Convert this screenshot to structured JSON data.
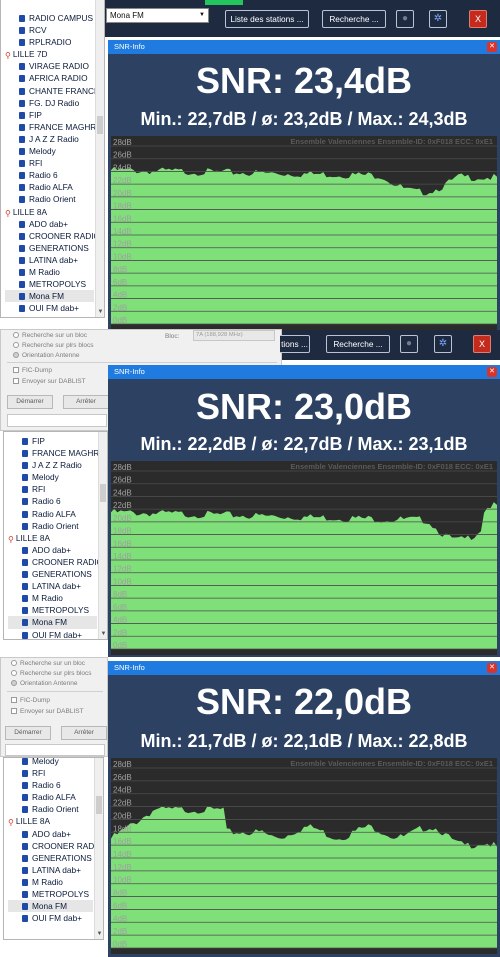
{
  "panel1": {
    "toolbar": {
      "station_select": "Mona FM",
      "stations_list_button": "Liste des stations ...",
      "search_button": "Recherche ...",
      "close_label": "X"
    },
    "stations": [
      {
        "label": "RADIO CAMPUS",
        "type": "station"
      },
      {
        "label": "RCV",
        "type": "station"
      },
      {
        "label": "RPLRADIO",
        "type": "station"
      },
      {
        "label": "LILLE 7D",
        "type": "group"
      },
      {
        "label": "VIRAGE RADIO",
        "type": "station"
      },
      {
        "label": "AFRICA RADIO",
        "type": "station"
      },
      {
        "label": "CHANTE FRANCE",
        "type": "station"
      },
      {
        "label": "FG. DJ Radio",
        "type": "station"
      },
      {
        "label": "FIP",
        "type": "station"
      },
      {
        "label": "FRANCE MAGHREB",
        "type": "station"
      },
      {
        "label": "J A Z Z Radio",
        "type": "station"
      },
      {
        "label": "Melody",
        "type": "station"
      },
      {
        "label": "RFI",
        "type": "station"
      },
      {
        "label": "Radio 6",
        "type": "station"
      },
      {
        "label": "Radio ALFA",
        "type": "station"
      },
      {
        "label": "Radio Orient",
        "type": "station"
      },
      {
        "label": "LILLE 8A",
        "type": "group"
      },
      {
        "label": "ADO dab+",
        "type": "station"
      },
      {
        "label": "CROONER RADIO",
        "type": "station"
      },
      {
        "label": "GENERATIONS",
        "type": "station"
      },
      {
        "label": "LATINA dab+",
        "type": "station"
      },
      {
        "label": "M Radio",
        "type": "station"
      },
      {
        "label": "METROPOLYS",
        "type": "station"
      },
      {
        "label": "Mona FM",
        "type": "station",
        "selected": true
      },
      {
        "label": "OUI FM dab+",
        "type": "station"
      }
    ],
    "snr": {
      "window_title": "SNR-Info",
      "value": "SNR: 23,4dB",
      "stats": "Min.: 22,7dB / ø: 23,2dB / Max.: 24,3dB",
      "graph_header": "Ensemble Valenciennes   Ensemble-ID: 0xF018   ECC: 0xE1"
    }
  },
  "panel2": {
    "options": {
      "radio_single_block": "Recherche sur un bloc",
      "radio_multi_block": "Recherche sur plrs blocs",
      "radio_antenna": "Orientation Antenne",
      "check_fic_dump": "FIC-Dump",
      "check_dablist": "Envoyer sur DABLIST",
      "start_button": "Démarrer",
      "stop_button": "Arrêter",
      "block_label": "Bloc:",
      "block_value": "7A (188,928 MHz)"
    },
    "toolbar": {
      "stations_list_fragment": "tions ...",
      "search_button": "Recherche ...",
      "close_label": "X"
    },
    "stations": [
      {
        "label": "FIP",
        "type": "station"
      },
      {
        "label": "FRANCE MAGHREB",
        "type": "station"
      },
      {
        "label": "J A Z Z Radio",
        "type": "station"
      },
      {
        "label": "Melody",
        "type": "station"
      },
      {
        "label": "RFI",
        "type": "station"
      },
      {
        "label": "Radio 6",
        "type": "station"
      },
      {
        "label": "Radio ALFA",
        "type": "station"
      },
      {
        "label": "Radio Orient",
        "type": "station"
      },
      {
        "label": "LILLE 8A",
        "type": "group"
      },
      {
        "label": "ADO dab+",
        "type": "station"
      },
      {
        "label": "CROONER RADIO",
        "type": "station"
      },
      {
        "label": "GENERATIONS",
        "type": "station"
      },
      {
        "label": "LATINA dab+",
        "type": "station"
      },
      {
        "label": "M Radio",
        "type": "station"
      },
      {
        "label": "METROPOLYS",
        "type": "station"
      },
      {
        "label": "Mona FM",
        "type": "station",
        "selected": true
      },
      {
        "label": "OUI FM dab+",
        "type": "station"
      }
    ],
    "snr": {
      "window_title": "SNR-Info",
      "value": "SNR: 23,0dB",
      "stats": "Min.: 22,2dB / ø: 22,7dB / Max.: 23,1dB",
      "graph_header": "Ensemble Valenciennes   Ensemble-ID: 0xF018   ECC: 0xE1"
    }
  },
  "panel3": {
    "options": {
      "radio_single_block": "Recherche sur un bloc",
      "radio_multi_block": "Recherche sur plrs blocs",
      "radio_antenna": "Orientation Antenne",
      "check_fic_dump": "FIC-Dump",
      "check_dablist": "Envoyer sur DABLIST",
      "start_button": "Démarrer",
      "stop_button": "Arrêter"
    },
    "stations": [
      {
        "label": "Melody",
        "type": "station"
      },
      {
        "label": "RFI",
        "type": "station"
      },
      {
        "label": "Radio 6",
        "type": "station"
      },
      {
        "label": "Radio ALFA",
        "type": "station"
      },
      {
        "label": "Radio Orient",
        "type": "station"
      },
      {
        "label": "LILLE 8A",
        "type": "group"
      },
      {
        "label": "ADO dab+",
        "type": "station"
      },
      {
        "label": "CROONER RADIO",
        "type": "station"
      },
      {
        "label": "GENERATIONS",
        "type": "station"
      },
      {
        "label": "LATINA dab+",
        "type": "station"
      },
      {
        "label": "M Radio",
        "type": "station"
      },
      {
        "label": "METROPOLYS",
        "type": "station"
      },
      {
        "label": "Mona FM",
        "type": "station",
        "selected": true
      },
      {
        "label": "OUI FM dab+",
        "type": "station"
      }
    ],
    "snr": {
      "window_title": "SNR-Info",
      "value": "SNR: 22,0dB",
      "stats": "Min.: 21,7dB / ø: 22,1dB / Max.: 22,8dB",
      "graph_header": "Ensemble Valenciennes   Ensemble-ID: 0xF018   ECC: 0xE1"
    }
  },
  "graph_axis": {
    "y_ticks": [
      "28dB",
      "26dB",
      "24dB",
      "22dB",
      "20dB",
      "18dB",
      "16dB",
      "14dB",
      "12dB",
      "10dB",
      "8dB",
      "6dB",
      "4dB",
      "2dB",
      "0dB"
    ]
  },
  "colors": {
    "snr_background": "#2d4263",
    "graph_fill": "#7fe07a",
    "graph_background": "#2b2b2b",
    "titlebar": "#1f7be0",
    "close_red": "#d9342b"
  }
}
